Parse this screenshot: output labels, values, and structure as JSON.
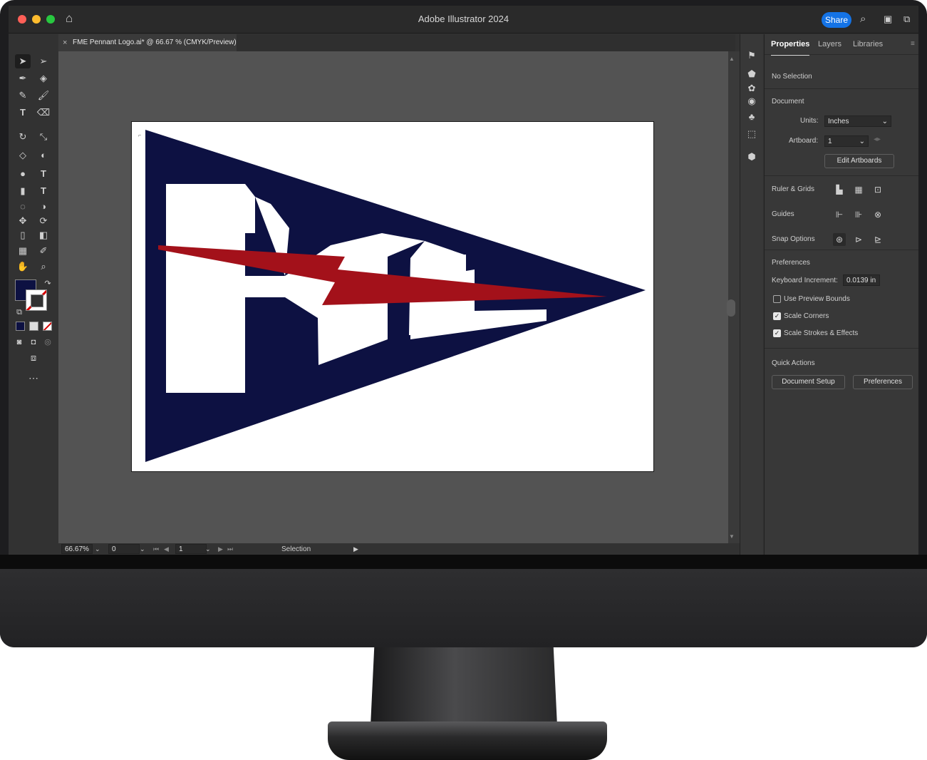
{
  "window": {
    "title": "Adobe Illustrator 2024",
    "share_label": "Share"
  },
  "document_tab": {
    "label": "FME Pennant Logo.ai* @ 66.67 % (CMYK/Preview)",
    "close_label": "×"
  },
  "status_bar": {
    "zoom": "66.67%",
    "rotation": "0",
    "artboard": "1",
    "tool": "Selection"
  },
  "panel": {
    "tabs": [
      "Properties",
      "Layers",
      "Libraries"
    ],
    "selection_status": "No Selection",
    "document_section": "Document",
    "units_label": "Units:",
    "units_value": "Inches",
    "artboard_label": "Artboard:",
    "artboard_value": "1",
    "edit_artboards": "Edit Artboards",
    "ruler_grids": "Ruler & Grids",
    "guides": "Guides",
    "snap_options": "Snap Options",
    "preferences_section": "Preferences",
    "keyboard_increment_label": "Keyboard Increment:",
    "keyboard_increment_value": "0.0139 in",
    "use_preview_bounds": "Use Preview Bounds",
    "scale_corners": "Scale Corners",
    "scale_strokes": "Scale Strokes & Effects",
    "quick_actions": "Quick Actions",
    "document_setup": "Document Setup",
    "preferences_button": "Preferences"
  },
  "checkboxes": {
    "use_preview_bounds": false,
    "scale_corners": true,
    "scale_strokes": true
  },
  "colors": {
    "fill": "#0d1142",
    "accent": "#1473e6",
    "logo_navy": "#0d1142",
    "logo_red": "#a3111a"
  },
  "icons": [
    "selection-tool-icon",
    "direct-selection-tool-icon",
    "pen-tool-icon",
    "type-tool-icon",
    "brush-tool-icon",
    "shape-tool-icon",
    "eyedropper-tool-icon",
    "zoom-tool-icon",
    "hand-tool-icon"
  ]
}
